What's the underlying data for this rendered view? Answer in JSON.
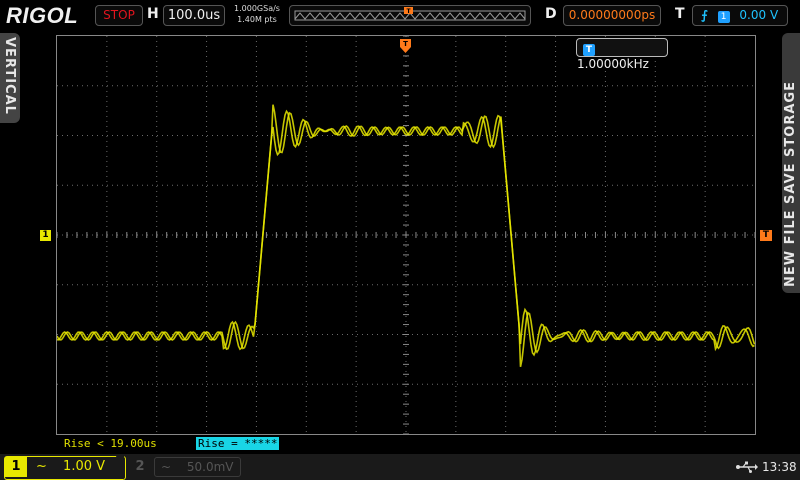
{
  "brand": "RIGOL",
  "run_state": "STOP",
  "horizontal": {
    "label": "H",
    "timebase": "100.0us"
  },
  "acquisition": {
    "sample_rate": "1.000GSa/s",
    "memory_depth": "1.40M pts"
  },
  "delay": {
    "label": "D",
    "value": "0.00000000ps"
  },
  "trigger": {
    "label": "T",
    "source": "1",
    "level": "0.00 V"
  },
  "side_tabs": {
    "left": "VERTICAL",
    "right": "NEW FILE   SAVE   STORAGE"
  },
  "frequency_counter": {
    "badge": "T",
    "value": "1.00000kHz"
  },
  "measurements": {
    "rise_line": "Rise < 19.00us",
    "rise_badge": "Rise = *****"
  },
  "channel1": {
    "number": "1",
    "coupling": "~",
    "scale": "1.00 V"
  },
  "channel2": {
    "number": "2",
    "coupling": "~",
    "scale": "50.0mV"
  },
  "clock": "13:38",
  "colors": {
    "ch1": "#e8e800",
    "trigger": "#ff7a1a",
    "accent": "#1fc3ff",
    "stop": "#e0141e"
  },
  "icons": [
    "usb-icon",
    "trigger-rising-edge-icon"
  ]
}
